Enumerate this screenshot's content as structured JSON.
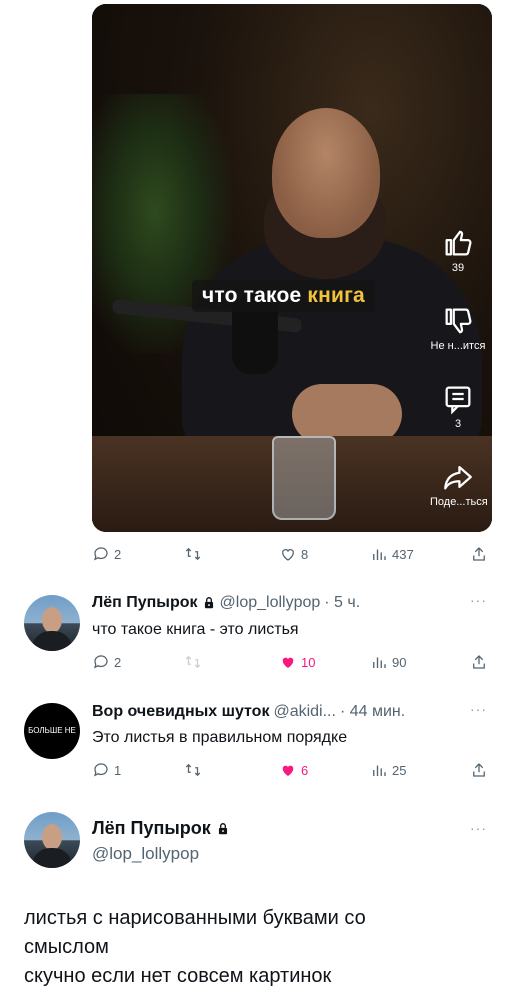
{
  "video": {
    "caption_plain": "что такое ",
    "caption_highlight": "книга",
    "side_actions": [
      {
        "icon": "thumbs-up-icon",
        "label": "39"
      },
      {
        "icon": "thumbs-down-icon",
        "label": "Не н...ится"
      },
      {
        "icon": "comment-icon",
        "label": "3"
      },
      {
        "icon": "share-icon",
        "label": "Поде...ться"
      }
    ]
  },
  "post_actions": {
    "replies": "2",
    "retweets": "",
    "likes": "8",
    "views": "437"
  },
  "replies": [
    {
      "avatar": "photo",
      "name": "Лёп Пупырок",
      "handle": "@lop_lollypop",
      "time": " · 5 ч.",
      "text": "что такое книга - это листья",
      "actions": {
        "replies": "2",
        "retweets": "",
        "likes": "10",
        "views": "90",
        "liked": true
      }
    },
    {
      "avatar_text": "БОЛЬШЕ НЕ",
      "name": "Вор очевидных шуток",
      "handle": "@akidi...",
      "time": " · 44 мин.",
      "text": "Это листья в правильном порядке",
      "actions": {
        "replies": "1",
        "retweets": "",
        "likes": "6",
        "views": "25",
        "liked": true
      }
    }
  ],
  "main_tweet": {
    "name": "Лёп Пупырок",
    "handle": "@lop_lollypop",
    "lines": [
      "листья с нарисованными буквами со",
      "смыслом",
      "скучно если нет совсем картинок"
    ]
  },
  "colors": {
    "like_pink": "#f91880",
    "muted": "#536471",
    "highlight": "#f2c23c"
  }
}
